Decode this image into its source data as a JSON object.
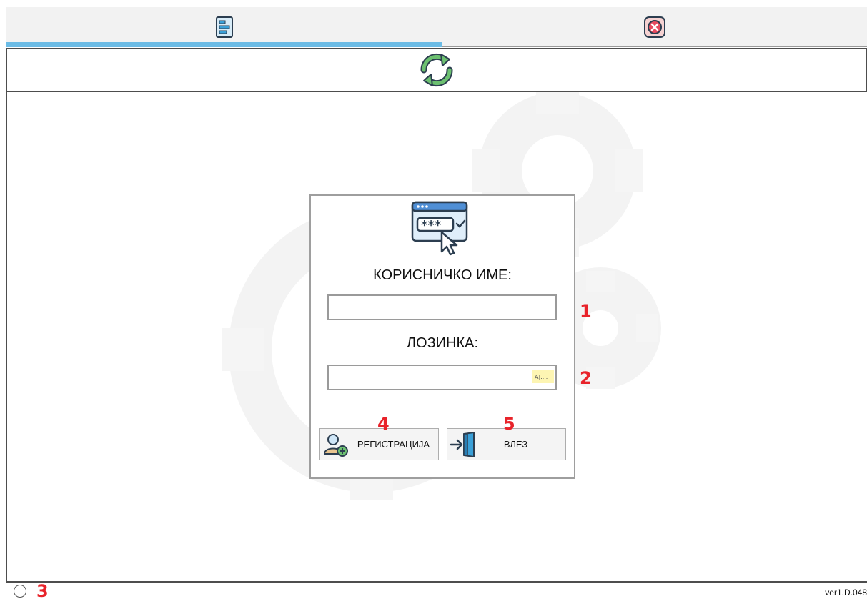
{
  "tabs": [
    {
      "icon": "form-document-icon",
      "active": true
    },
    {
      "icon": "close-red-icon",
      "active": false
    }
  ],
  "toolbar": {
    "refresh_icon": "refresh-arrows-icon"
  },
  "login": {
    "icon": "password-login-icon",
    "username_label": "КОРИСНИЧКО ИМЕ:",
    "username_value": "",
    "password_label": "ЛОЗИНКА:",
    "password_value": "",
    "register_label": "РЕГИСТРАЦИЈА",
    "login_label": "ВЛЕЗ"
  },
  "annotations": {
    "m1": "1",
    "m2": "2",
    "m3": "3",
    "m4": "4",
    "m5": "5"
  },
  "status": {
    "version": "ver1.D.048"
  },
  "colors": {
    "tab_accent": "#6cbce6",
    "marker_red": "#e8232a",
    "refresh_green": "#5cb85c"
  }
}
